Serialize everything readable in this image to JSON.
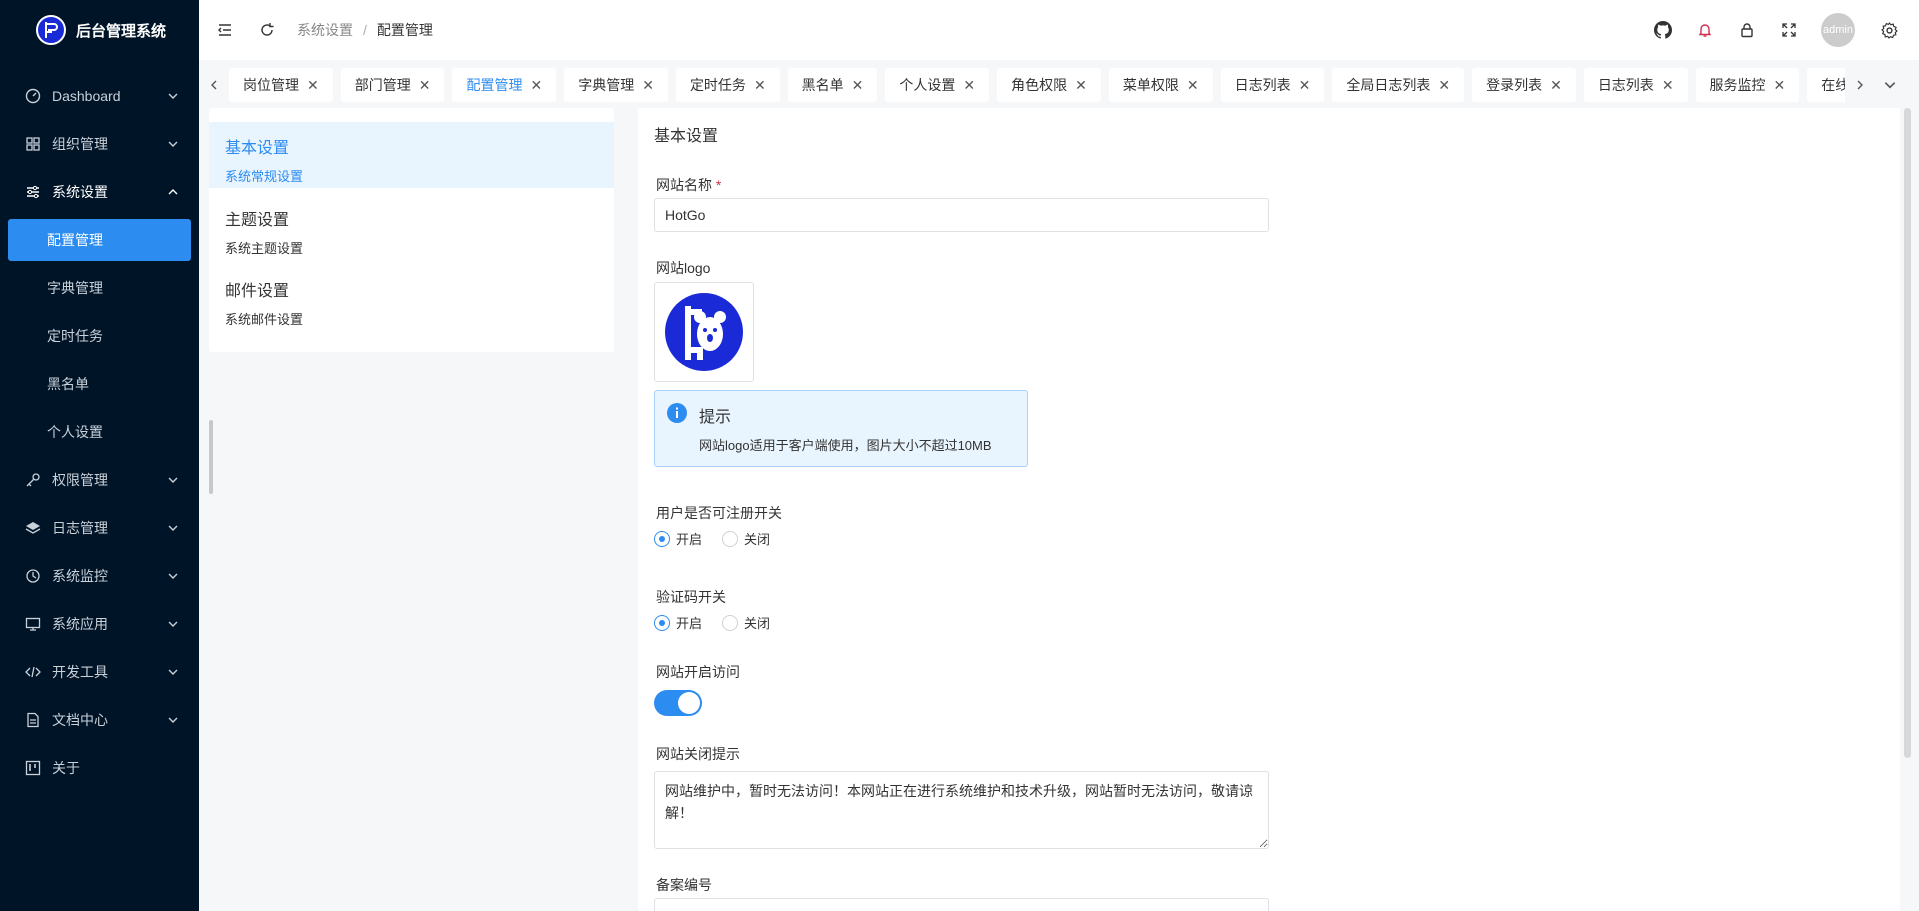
{
  "brand": {
    "title": "后台管理系统"
  },
  "sidebar": {
    "items": [
      {
        "label": "Dashboard",
        "icon": "dashboard-icon"
      },
      {
        "label": "组织管理",
        "icon": "grid-icon"
      },
      {
        "label": "系统设置",
        "icon": "sliders-icon",
        "open": true,
        "children": [
          {
            "label": "配置管理",
            "active": true
          },
          {
            "label": "字典管理"
          },
          {
            "label": "定时任务"
          },
          {
            "label": "黑名单"
          },
          {
            "label": "个人设置"
          }
        ]
      },
      {
        "label": "权限管理",
        "icon": "key-icon"
      },
      {
        "label": "日志管理",
        "icon": "layers-icon"
      },
      {
        "label": "系统监控",
        "icon": "monitor-clock-icon"
      },
      {
        "label": "系统应用",
        "icon": "screen-icon"
      },
      {
        "label": "开发工具",
        "icon": "code-icon"
      },
      {
        "label": "文档中心",
        "icon": "document-icon"
      },
      {
        "label": "关于",
        "icon": "trello-icon"
      }
    ]
  },
  "header": {
    "breadcrumb": [
      "系统设置",
      "配置管理"
    ],
    "avatar_text": "admin",
    "icons": [
      "github-icon",
      "bell-icon",
      "lock-icon",
      "fullscreen-icon",
      "settings-icon"
    ],
    "bell_color": "#d03050"
  },
  "tabs": [
    {
      "label": "岗位管理"
    },
    {
      "label": "部门管理"
    },
    {
      "label": "配置管理",
      "active": true
    },
    {
      "label": "字典管理"
    },
    {
      "label": "定时任务"
    },
    {
      "label": "黑名单"
    },
    {
      "label": "个人设置"
    },
    {
      "label": "角色权限"
    },
    {
      "label": "菜单权限"
    },
    {
      "label": "日志列表"
    },
    {
      "label": "全局日志列表"
    },
    {
      "label": "登录列表"
    },
    {
      "label": "日志列表"
    },
    {
      "label": "服务监控"
    },
    {
      "label": "在线用"
    }
  ],
  "settings_menu": [
    {
      "title": "基本设置",
      "desc": "系统常规设置",
      "active": true
    },
    {
      "title": "主题设置",
      "desc": "系统主题设置"
    },
    {
      "title": "邮件设置",
      "desc": "系统邮件设置"
    }
  ],
  "form": {
    "title": "基本设置",
    "site_name_label": "网站名称",
    "required_mark": "*",
    "site_name_value": "HotGo",
    "logo_label": "网站logo",
    "alert_title": "提示",
    "alert_message": "网站logo适用于客户端使用，图片大小不超过10MB",
    "register_label": "用户是否可注册开关",
    "captcha_label": "验证码开关",
    "open_label": "开启",
    "close_label": "关闭",
    "register_value": "开启",
    "captcha_value": "开启",
    "site_open_label": "网站开启访问",
    "site_open_value": true,
    "close_tip_label": "网站关闭提示",
    "close_tip_value": "网站维护中，暂时无法访问！本网站正在进行系统维护和技术升级，网站暂时无法访问，敬请谅解！",
    "icp_label": "备案编号"
  },
  "colors": {
    "sidebar_bg": "#001428",
    "accent": "#2d8cf0",
    "alert_bg": "#e8f4fe"
  }
}
